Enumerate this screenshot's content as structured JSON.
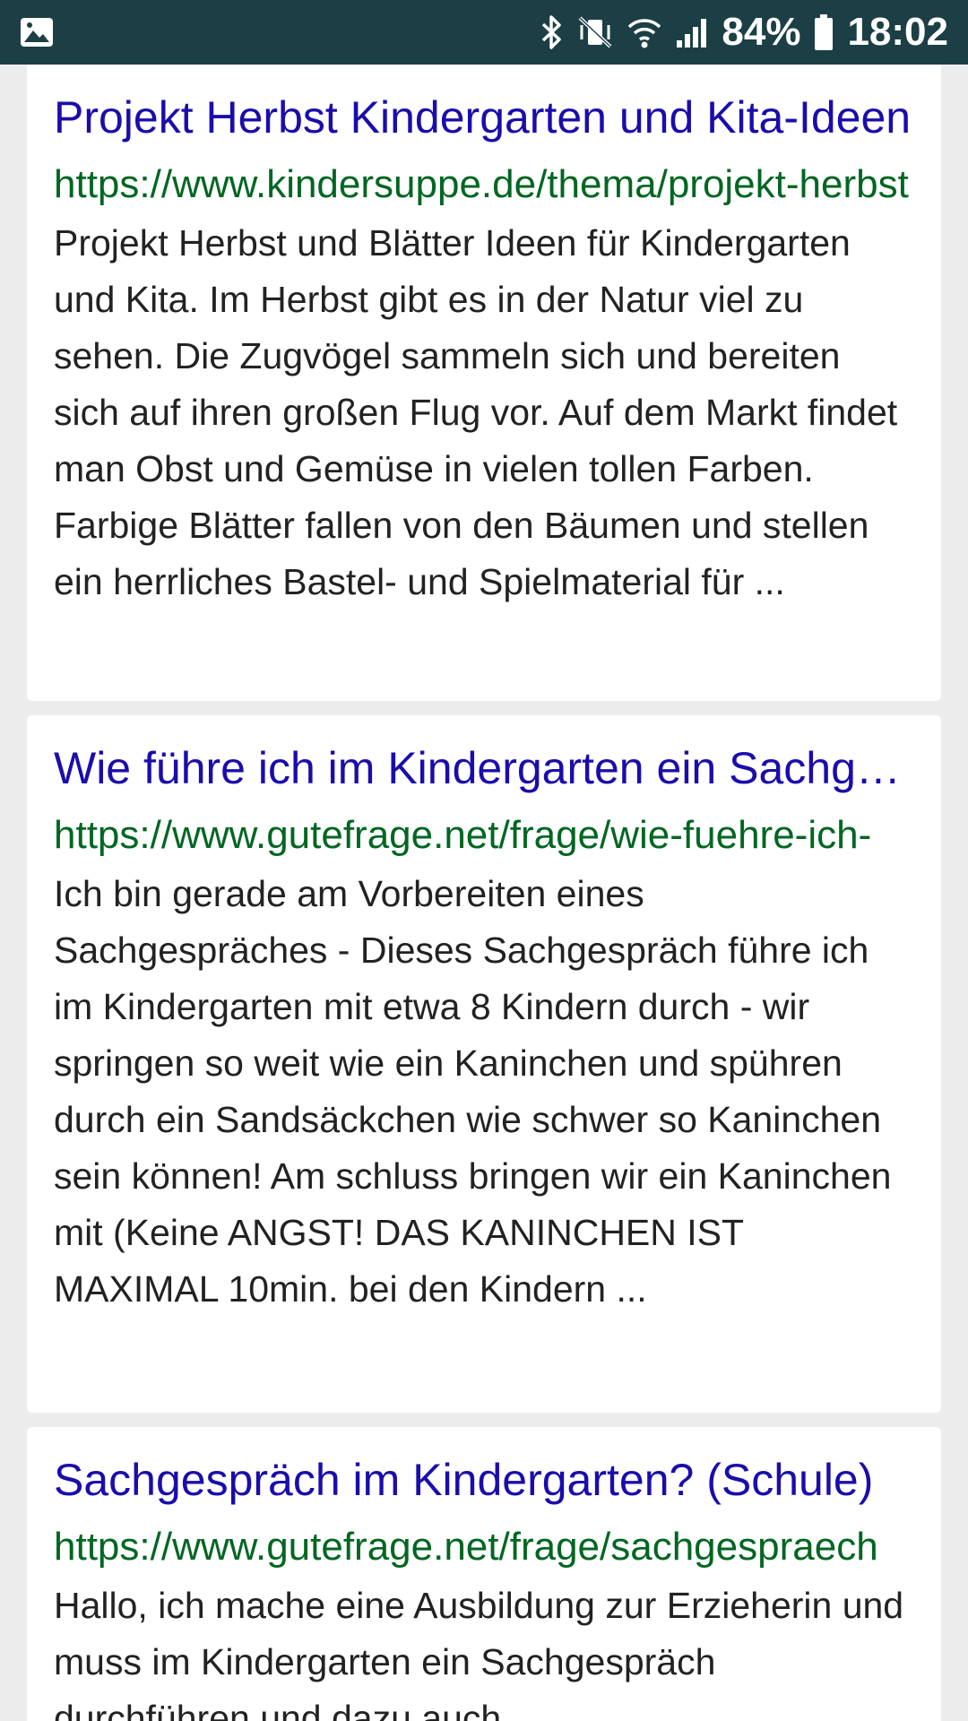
{
  "status_bar": {
    "battery": "84%",
    "time": "18:02",
    "icons": [
      "gallery-icon",
      "bluetooth-icon",
      "vibrate-mute-icon",
      "wifi-icon",
      "signal-icon",
      "battery-icon"
    ]
  },
  "results": [
    {
      "title": "Projekt Herbst Kindergarten und Kita-Ideen",
      "url": "https://www.kindersuppe.de/thema/projekt-herbst",
      "snippet": "Projekt Herbst und Blätter Ideen für Kindergarten und Kita. Im Herbst gibt es in der Natur viel zu sehen. Die Zugvögel sammeln sich und bereiten sich auf ihren großen Flug vor. Auf dem Markt findet man Obst und Gemüse in vielen tollen Farben. Farbige Blätter fallen von den Bäumen und stellen ein herrliches Bastel- und Spielmaterial für ..."
    },
    {
      "title": "Wie führe ich im Kindergarten ein Sachgespräch",
      "url": "https://www.gutefrage.net/frage/wie-fuehre-ich-",
      "snippet": "Ich bin gerade am Vorbereiten eines Sachgespräches - Dieses Sachgespräch führe ich im Kindergarten mit etwa 8 Kindern durch - wir springen so weit wie ein Kaninchen und spühren durch ein Sandsäckchen wie schwer so Kaninchen sein können! Am schluss bringen wir ein Kaninchen mit (Keine ANGST! DAS KANINCHEN IST MAXIMAL 10min. bei den Kindern ..."
    },
    {
      "title": "Sachgespräch im Kindergarten? (Schule)",
      "url": "https://www.gutefrage.net/frage/sachgespraech",
      "snippet": "Hallo, ich mache eine Ausbildung zur Erzieherin und muss im Kindergarten ein Sachgespräch durchführen und dazu auch"
    }
  ]
}
